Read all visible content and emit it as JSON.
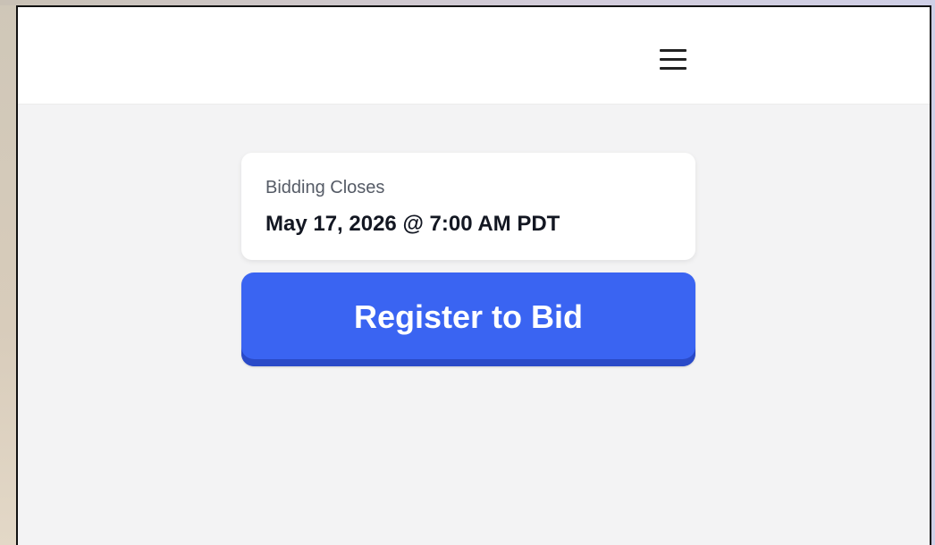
{
  "header": {
    "menu_icon": "hamburger-menu-icon"
  },
  "auction": {
    "closing_label": "Bidding Closes",
    "closing_datetime": "May 17, 2026 @ 7:00 AM PDT"
  },
  "actions": {
    "register_label": "Register to Bid"
  },
  "colors": {
    "primary": "#3a64f2",
    "primary_dark": "#2a4ac8",
    "page_background": "#f3f3f4",
    "card_background": "#ffffff"
  }
}
